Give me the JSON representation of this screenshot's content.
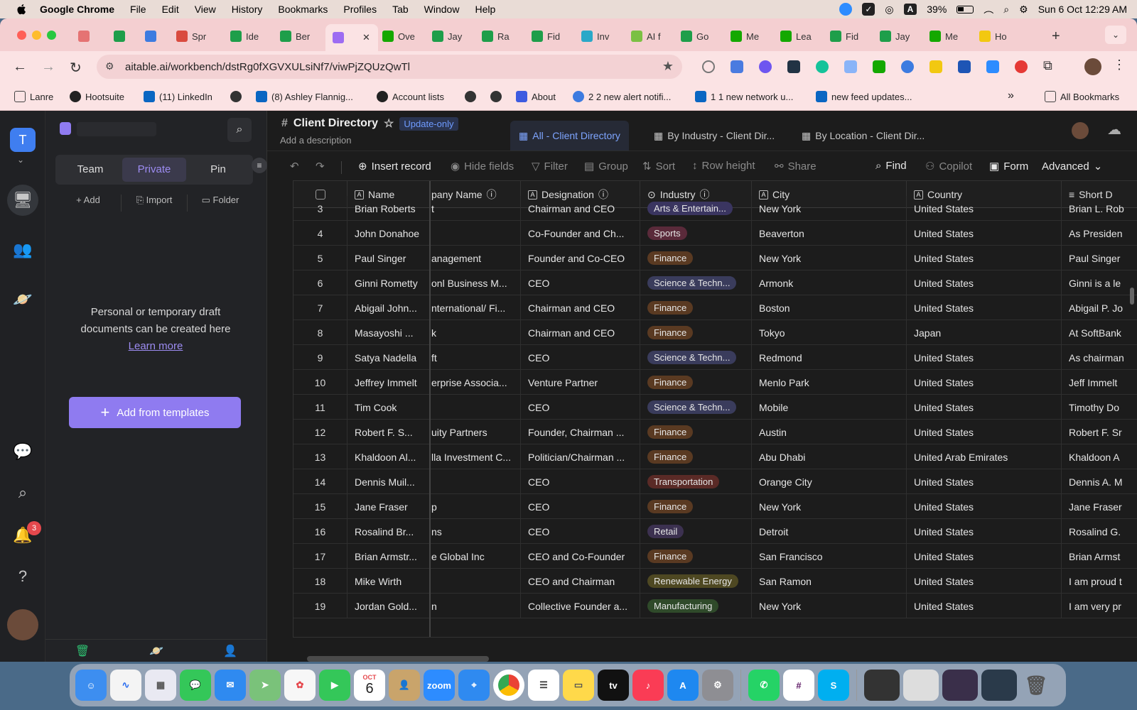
{
  "menubar": {
    "app_name": "Google Chrome",
    "items": [
      "File",
      "Edit",
      "View",
      "History",
      "Bookmarks",
      "Profiles",
      "Tab",
      "Window",
      "Help"
    ],
    "battery": "39%",
    "datetime": "Sun 6 Oct  12:29 AM"
  },
  "tabs": [
    {
      "label": "",
      "color": "#e57373"
    },
    {
      "label": "",
      "color": "#1e9e4a"
    },
    {
      "label": "",
      "color": "#3d7be0"
    },
    {
      "label": "Spr",
      "color": "#d94b3f"
    },
    {
      "label": "Ide",
      "color": "#1e9e4a"
    },
    {
      "label": "Ber",
      "color": "#1e9e4a"
    },
    {
      "label": "",
      "color": "#9d6cf2",
      "active": true
    },
    {
      "label": "Ove",
      "color": "#14a800"
    },
    {
      "label": "Jay",
      "color": "#1e9e4a"
    },
    {
      "label": "Ra",
      "color": "#1e9e4a"
    },
    {
      "label": "Fid",
      "color": "#1e9e4a"
    },
    {
      "label": "Inv",
      "color": "#2aa8c8"
    },
    {
      "label": "AI f",
      "color": "#7bc043"
    },
    {
      "label": "Go",
      "color": "#1e9e4a"
    },
    {
      "label": "Me",
      "color": "#14a800"
    },
    {
      "label": "Lea",
      "color": "#14a800"
    },
    {
      "label": "Fid",
      "color": "#1e9e4a"
    },
    {
      "label": "Jay",
      "color": "#1e9e4a"
    },
    {
      "label": "Me",
      "color": "#14a800"
    },
    {
      "label": "Ho",
      "color": "#f2c811"
    }
  ],
  "omnibox": {
    "url": "aitable.ai/workbench/dstRg0fXGVXULsiNf7/viwPjZQUzQwTl"
  },
  "bookmarks": [
    "Lanre",
    "Hootsuite",
    "(11) LinkedIn",
    "",
    "(8) Ashley Flannig...",
    "Account lists",
    "",
    "",
    "About",
    "2 2 new alert notifi...",
    "1 1 new network u...",
    "new feed updates..."
  ],
  "bookmarks_all": "All Bookmarks",
  "rail": {
    "workspace_initial": "T",
    "notification_count": "3"
  },
  "sidebar": {
    "segments": [
      "Team",
      "Private",
      "Pin"
    ],
    "actions": [
      "Add",
      "Import",
      "Folder"
    ],
    "empty_text": "Personal or temporary draft documents can be created here",
    "learn_more": "Learn more",
    "add_templates": "Add from templates"
  },
  "view": {
    "title": "Client Directory",
    "badge": "Update-only",
    "description": "Add a description",
    "tabs": [
      "All - Client Directory",
      "By Industry - Client Dir...",
      "By Location - Client Dir..."
    ]
  },
  "toolbar": {
    "insert": "Insert record",
    "hide_fields": "Hide fields",
    "filter": "Filter",
    "group": "Group",
    "sort": "Sort",
    "row_height": "Row height",
    "share": "Share",
    "find": "Find",
    "copilot": "Copilot",
    "form": "Form",
    "advanced": "Advanced"
  },
  "columns": [
    "Name",
    "pany Name",
    "Designation",
    "Industry",
    "City",
    "Country",
    "Short D"
  ],
  "industry_colors": {
    "Arts & Entertain...": "#3a3560",
    "Sports": "#5a2a3a",
    "Finance": "#5a3a22",
    "Science & Techn...": "#3a3c5c",
    "Transportation": "#5a2a26",
    "Retail": "#3c3150",
    "Renewable Energy": "#4e4822",
    "Manufacturing": "#2f4a2a"
  },
  "rows": [
    {
      "n": "3",
      "name": "Brian Roberts",
      "company": "t",
      "designation": "Chairman and CEO",
      "industry": "Arts & Entertain...",
      "city": "New York",
      "country": "United States",
      "short": "Brian L. Rob"
    },
    {
      "n": "4",
      "name": "John Donahoe",
      "company": "",
      "designation": "Co-Founder and Ch...",
      "industry": "Sports",
      "city": "Beaverton",
      "country": "United States",
      "short": "As Presiden"
    },
    {
      "n": "5",
      "name": "Paul Singer",
      "company": "anagement",
      "designation": "Founder and Co-CEO",
      "industry": "Finance",
      "city": "New York",
      "country": "United States",
      "short": "Paul Singer"
    },
    {
      "n": "6",
      "name": "Ginni Rometty",
      "company": "onl Business M...",
      "designation": "CEO",
      "industry": "Science & Techn...",
      "city": "Armonk",
      "country": "United States",
      "short": "Ginni is a le"
    },
    {
      "n": "7",
      "name": "Abigail John...",
      "company": "nternational/ Fi...",
      "designation": "Chairman and CEO",
      "industry": "Finance",
      "city": "Boston",
      "country": "United States",
      "short": "Abigail P. Jo"
    },
    {
      "n": "8",
      "name": "Masayoshi ...",
      "company": "k",
      "designation": "Chairman and CEO",
      "industry": "Finance",
      "city": "Tokyo",
      "country": "Japan",
      "short": "At SoftBank"
    },
    {
      "n": "9",
      "name": "Satya Nadella",
      "company": "ft",
      "designation": "CEO",
      "industry": "Science & Techn...",
      "city": "Redmond",
      "country": "United States",
      "short": "As chairman"
    },
    {
      "n": "10",
      "name": "Jeffrey Immelt",
      "company": "erprise Associa...",
      "designation": "Venture Partner",
      "industry": "Finance",
      "city": "Menlo Park",
      "country": "United States",
      "short": "Jeff Immelt"
    },
    {
      "n": "11",
      "name": "Tim Cook",
      "company": "",
      "designation": "CEO",
      "industry": "Science & Techn...",
      "city": "Mobile",
      "country": "United States",
      "short": "Timothy Do"
    },
    {
      "n": "12",
      "name": "Robert F. S...",
      "company": "uity Partners",
      "designation": "Founder, Chairman ...",
      "industry": "Finance",
      "city": "Austin",
      "country": "United States",
      "short": "Robert F. Sr"
    },
    {
      "n": "13",
      "name": "Khaldoon Al...",
      "company": "lla Investment C...",
      "designation": "Politician/Chairman ...",
      "industry": "Finance",
      "city": "Abu Dhabi",
      "country": "United Arab Emirates",
      "short": "Khaldoon A"
    },
    {
      "n": "14",
      "name": "Dennis Muil...",
      "company": "",
      "designation": "CEO",
      "industry": "Transportation",
      "city": "Orange City",
      "country": "United States",
      "short": "Dennis A. M"
    },
    {
      "n": "15",
      "name": "Jane Fraser",
      "company": "p",
      "designation": "CEO",
      "industry": "Finance",
      "city": "New York",
      "country": "United States",
      "short": "Jane Fraser"
    },
    {
      "n": "16",
      "name": "Rosalind Br...",
      "company": "ns",
      "designation": "CEO",
      "industry": "Retail",
      "city": "Detroit",
      "country": "United States",
      "short": "Rosalind G."
    },
    {
      "n": "17",
      "name": "Brian Armstr...",
      "company": "e Global Inc",
      "designation": "CEO and Co-Founder",
      "industry": "Finance",
      "city": "San Francisco",
      "country": "United States",
      "short": "Brian Armst"
    },
    {
      "n": "18",
      "name": "Mike Wirth",
      "company": "",
      "designation": "CEO and Chairman",
      "industry": "Renewable Energy",
      "city": "San Ramon",
      "country": "United States",
      "short": "I am proud t"
    },
    {
      "n": "19",
      "name": "Jordan Gold...",
      "company": "n",
      "designation": "Collective Founder a...",
      "industry": "Manufacturing",
      "city": "New York",
      "country": "United States",
      "short": "I am very pr"
    }
  ],
  "dock": {
    "calendar_month": "OCT",
    "calendar_day": "6",
    "zoom_label": "zoom",
    "tv_label": "tv"
  }
}
